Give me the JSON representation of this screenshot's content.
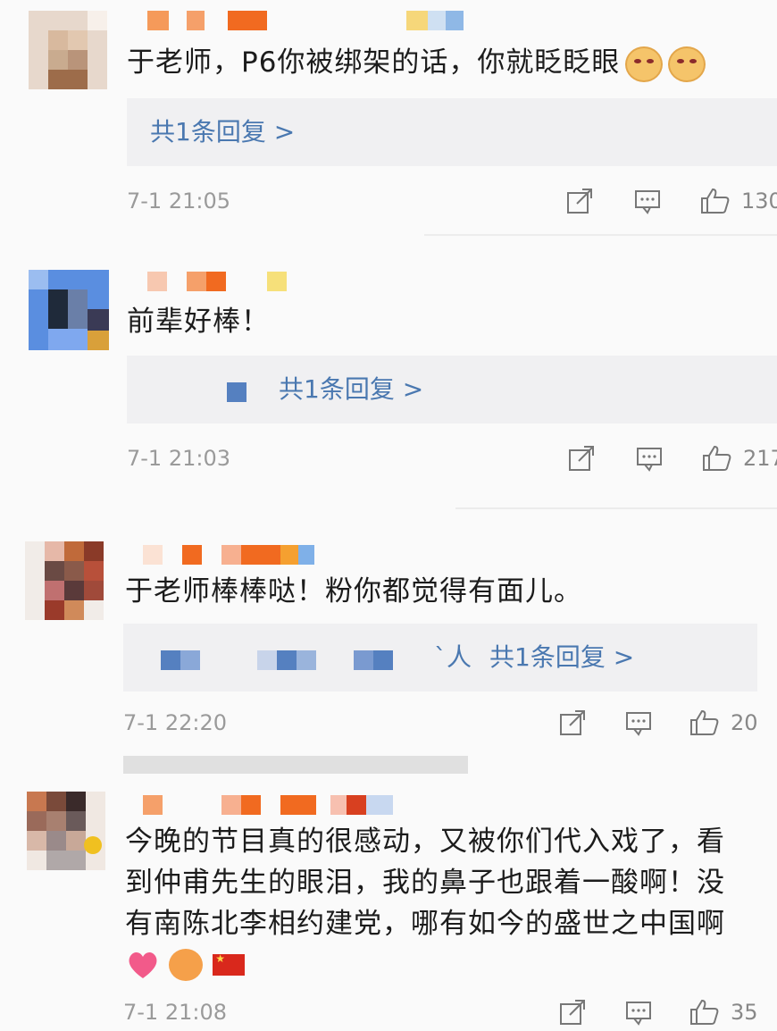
{
  "comments": [
    {
      "text": "于老师，P6你被绑架的话，你就眨眨眼",
      "reply_link": "共1条回复 >",
      "time": "7-1 21:05",
      "likes": "130"
    },
    {
      "text": "前辈好棒！",
      "reply_link": "共1条回复 >",
      "time": "7-1 21:03",
      "likes": "217"
    },
    {
      "text": "于老师棒棒哒！粉你都觉得有面儿。",
      "reply_prefix": "`人",
      "reply_link": "共1条回复 >",
      "time": "7-1 22:20",
      "likes": "20"
    },
    {
      "text_lines": [
        "今晚的节目真的很感动，又被你们代入戏了，看",
        "到仲甫先生的眼泪，我的鼻子也跟着一酸啊！没",
        "有南陈北李相约建党，哪有如今的盛世之中国啊"
      ],
      "time": "7-1 21:08",
      "likes": "35"
    }
  ],
  "icons": {
    "share": "share-icon",
    "comment": "comment-icon",
    "like": "thumbs-up-icon"
  },
  "colors": {
    "link": "#4a78b0",
    "meta": "#9a9a9a",
    "reply_bg": "#f0f0f2"
  }
}
